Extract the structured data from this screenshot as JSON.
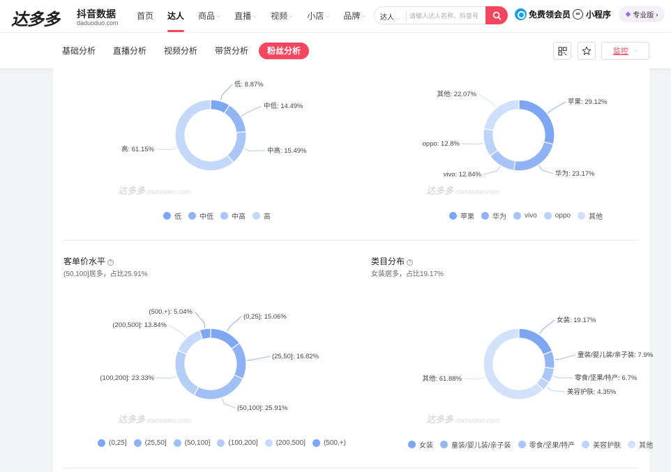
{
  "logo": {
    "main": "达多多",
    "cn": "抖音数据",
    "en": "daduoduo.com"
  },
  "nav": [
    {
      "label": "首页",
      "caret": false,
      "active": false
    },
    {
      "label": "达人",
      "caret": false,
      "active": true
    },
    {
      "label": "商品",
      "caret": true,
      "active": false
    },
    {
      "label": "直播",
      "caret": true,
      "active": false
    },
    {
      "label": "视频",
      "caret": true,
      "active": false
    },
    {
      "label": "小店",
      "caret": true,
      "active": false
    },
    {
      "label": "品牌",
      "caret": true,
      "active": false
    }
  ],
  "search": {
    "type": "达人",
    "placeholder": "请输入达人名称、抖音号"
  },
  "header": {
    "vip": "免费领会员",
    "miniprogram": "小程序",
    "pro": "专业版"
  },
  "subtabs": [
    {
      "label": "基础分析",
      "active": false
    },
    {
      "label": "直播分析",
      "active": false
    },
    {
      "label": "视频分析",
      "active": false
    },
    {
      "label": "带货分析",
      "active": false
    },
    {
      "label": "粉丝分析",
      "active": true
    }
  ],
  "monitor": {
    "label": "监控"
  },
  "watermark": {
    "cn": "达多多",
    "en": "daduoduo.com"
  },
  "sections": {
    "price": {
      "title": "客单价水平",
      "subtitle": "(50,100]居多，占比25.91%"
    },
    "category": {
      "title": "类目分布",
      "subtitle": "女装居多，占比19.17%"
    }
  },
  "chart_data": [
    {
      "id": "consumption",
      "type": "pie",
      "categories": [
        "低",
        "中低",
        "中高",
        "高"
      ],
      "values": [
        8.87,
        14.49,
        15.49,
        61.15
      ],
      "labels": [
        "低: 8.87%",
        "中低: 14.49%",
        "中高: 15.49%",
        "高: 61.15%"
      ],
      "colors": [
        "#7da7f2",
        "#92b6f4",
        "#aac6f7",
        "#c4d8fa"
      ]
    },
    {
      "id": "phone",
      "type": "pie",
      "categories": [
        "苹果",
        "华为",
        "vivo",
        "oppo",
        "其他"
      ],
      "values": [
        29.12,
        23.17,
        12.84,
        12.8,
        22.07
      ],
      "labels": [
        "苹果: 29.12%",
        "华为: 23.17%",
        "vivo: 12.84%",
        "oppo: 12.8%",
        "其他: 22.07%"
      ],
      "colors": [
        "#7da7f2",
        "#8fb3f4",
        "#a8c4f7",
        "#bcd3f9",
        "#cfe0fb"
      ]
    },
    {
      "id": "price",
      "type": "pie",
      "categories": [
        "(0,25]",
        "(25,50]",
        "(50,100]",
        "(100,200]",
        "(200,500]",
        "(500,+)"
      ],
      "values": [
        15.06,
        16.82,
        25.91,
        23.33,
        13.84,
        5.04
      ],
      "labels": [
        "(0,25]: 15.06%",
        "(25,50]: 16.82%",
        "(50,100]: 25.91%",
        "(100,200]: 23.33%",
        "(200,500]: 13.84%",
        "(500,+): 5.04%"
      ],
      "colors": [
        "#7da7f2",
        "#8cb1f4",
        "#a1c0f6",
        "#b4cef8",
        "#c6dafa",
        "#7da7f2"
      ]
    },
    {
      "id": "category",
      "type": "pie",
      "categories": [
        "女装",
        "童装/婴儿装/亲子装",
        "零食/坚果/特产",
        "美容护肤",
        "其他"
      ],
      "values": [
        19.17,
        7.9,
        6.7,
        4.35,
        61.88
      ],
      "labels": [
        "女装: 19.17%",
        "童装/婴儿装/亲子装: 7.9%",
        "零食/坚果/特产: 6.7%",
        "美容护肤: 4.35%",
        "其他: 61.88%"
      ],
      "colors": [
        "#7da7f2",
        "#92b6f4",
        "#aac6f7",
        "#bdd3f9",
        "#d2e2fb"
      ]
    }
  ]
}
